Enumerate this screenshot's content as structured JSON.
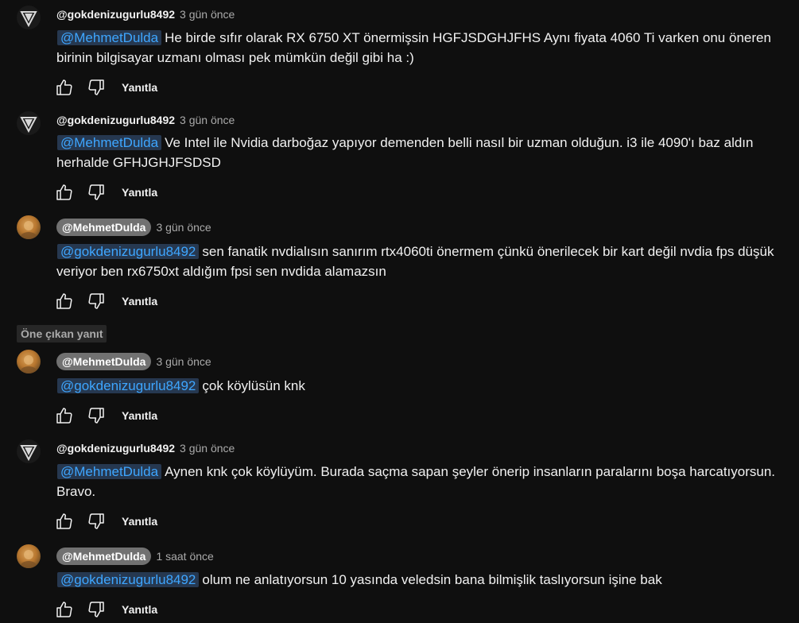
{
  "icons": {
    "like": "thumb-up-icon",
    "dislike": "thumb-down-icon"
  },
  "colors": {
    "mention": "#3ea6ff",
    "mention_bg": "#263850",
    "owner_badge": "#717171",
    "background": "#0f0f0f"
  },
  "highlight_label": "Öne çıkan yanıt",
  "comments": [
    {
      "author": "@gokdenizugurlu8492",
      "time": "3 gün önce",
      "mention": "@MehmetDulda",
      "text": "He birde sıfır olarak RX 6750 XT önermişsin HGFJSDGHJFHS Aynı fiyata 4060 Ti varken onu öneren birinin bilgisayar uzmanı olması pek mümkün değil gibi ha :)",
      "reply": "Yanıtla"
    },
    {
      "author": "@gokdenizugurlu8492",
      "time": "3 gün önce",
      "mention": "@MehmetDulda",
      "text": "Ve Intel ile Nvidia darboğaz yapıyor demenden belli nasıl bir uzman olduğun. i3 ile 4090'ı baz aldın herhalde GFHJGHJFSDSD",
      "reply": "Yanıtla"
    },
    {
      "author": "@MehmetDulda",
      "time": "3 gün önce",
      "mention": "@gokdenizugurlu8492",
      "text": "sen fanatik nvdialısın sanırım rtx4060ti önermem çünkü önerilecek bir kart değil nvdia fps düşük veriyor ben rx6750xt aldığım fpsi sen nvdida alamazsın",
      "reply": "Yanıtla"
    },
    {
      "author": "@MehmetDulda",
      "time": "3 gün önce",
      "mention": "@gokdenizugurlu8492",
      "text": "çok köylüsün knk",
      "reply": "Yanıtla"
    },
    {
      "author": "@gokdenizugurlu8492",
      "time": "3 gün önce",
      "mention": "@MehmetDulda",
      "text": "Aynen knk çok köylüyüm. Burada saçma sapan şeyler önerip insanların paralarını boşa harcatıyorsun. Bravo.",
      "reply": "Yanıtla"
    },
    {
      "author": "@MehmetDulda",
      "time": "1 saat önce",
      "mention": "@gokdenizugurlu8492",
      "text": "olum ne anlatıyorsun 10 yasında veledsin bana bilmişlik taslıyorsun işine bak",
      "reply": "Yanıtla"
    }
  ]
}
